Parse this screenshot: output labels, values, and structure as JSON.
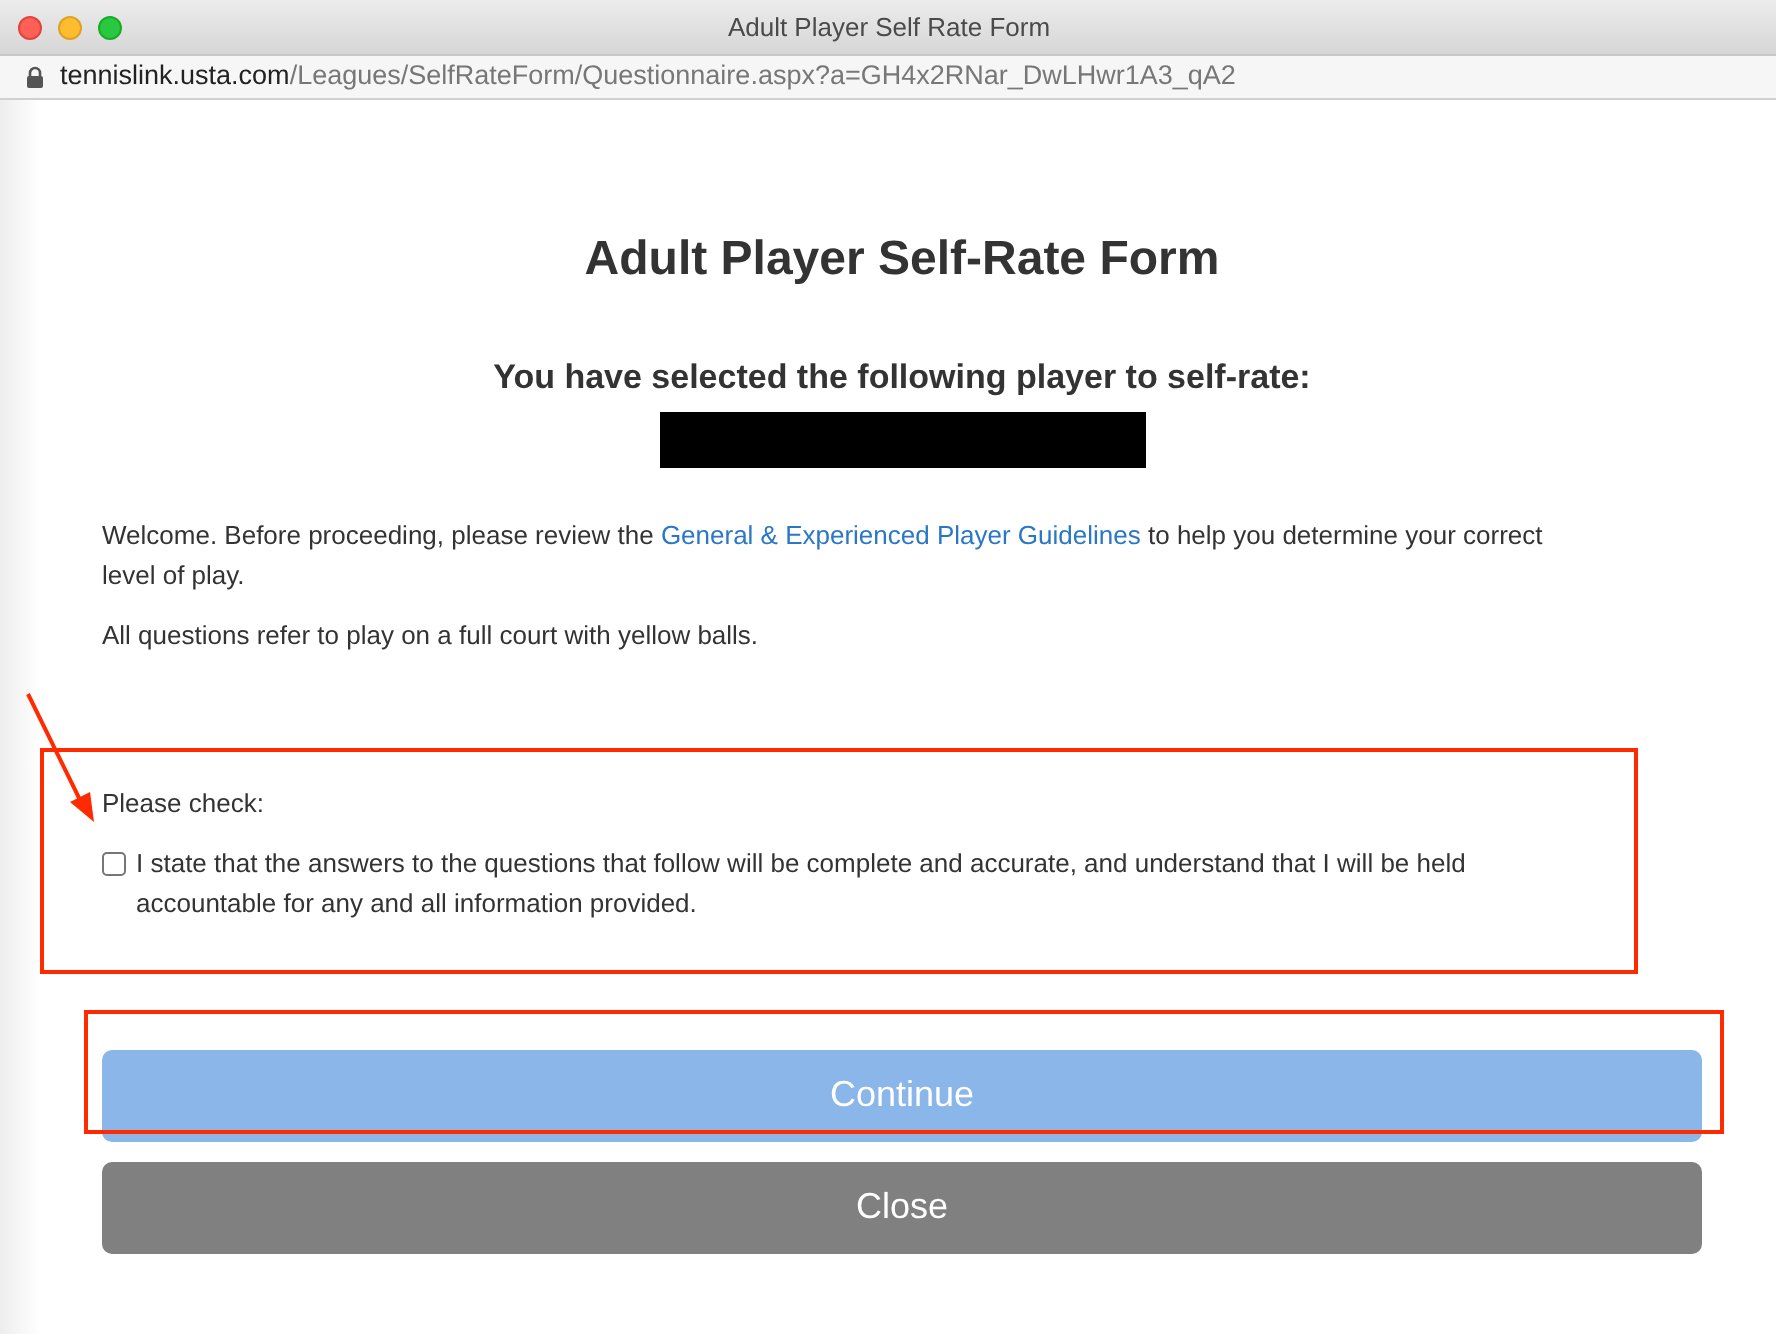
{
  "window": {
    "title": "Adult Player Self Rate Form"
  },
  "address_bar": {
    "host": "tennislink.usta.com",
    "path": "/Leagues/SelfRateForm/Questionnaire.aspx?a=GH4x2RNar_DwLHwr1A3_qA2"
  },
  "heading": "Adult Player Self-Rate Form",
  "subheading": "You have selected the following player to self-rate:",
  "intro": {
    "before": "Welcome. Before proceeding, please review the",
    "link": "General & Experienced Player Guidelines",
    "after": "to help you determine your correct level of play."
  },
  "note": "All questions refer to play on a full court with yellow balls.",
  "check_label": "Please check:",
  "agreement": {
    "checked": false,
    "text": "I state that the answers to the questions that follow will be complete and accurate, and understand that I will be held accountable for any and all information provided."
  },
  "buttons": [
    {
      "kind": "primary",
      "label": "Continue",
      "disabled": true
    },
    {
      "kind": "secondary",
      "label": "Close",
      "disabled": false
    }
  ]
}
